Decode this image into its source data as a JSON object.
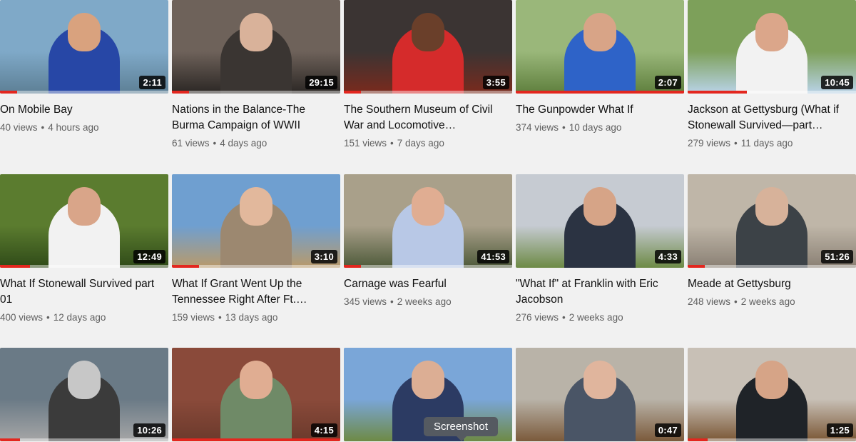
{
  "videos": [
    {
      "title": "On Mobile Bay",
      "views": "40 views",
      "age": "4 hours ago",
      "duration": "2:11",
      "progress": 0.1,
      "bg": "#7fa9c8",
      "bg2": "#5d7f95",
      "shirt": "#2747a6",
      "skin": "#d9a27e"
    },
    {
      "title": "Nations in the Balance-The Burma Campaign of WWII",
      "views": "61 views",
      "age": "4 days ago",
      "duration": "29:15",
      "progress": 0.1,
      "bg": "#6e625a",
      "bg2": "#2b2724",
      "shirt": "#3a3532",
      "skin": "#d9b29a"
    },
    {
      "title": "The Southern Museum of Civil War and Locomotive…",
      "views": "151 views",
      "age": "7 days ago",
      "duration": "3:55",
      "progress": 0.1,
      "bg": "#3b3433",
      "bg2": "#7a2a1d",
      "shirt": "#d52b2b",
      "skin": "#6a3f2a"
    },
    {
      "title": "The Gunpowder What If",
      "views": "374 views",
      "age": "10 days ago",
      "duration": "2:07",
      "progress": 1.0,
      "bg": "#9ab77a",
      "bg2": "#5f7f3d",
      "shirt": "#2e63c8",
      "skin": "#d8a487"
    },
    {
      "title": "Jackson at Gettysburg (What if Stonewall Survived—part…",
      "views": "279 views",
      "age": "11 days ago",
      "duration": "10:45",
      "progress": 0.35,
      "bg": "#7da05a",
      "bg2": "#b9d3e8",
      "shirt": "#f2f2f2",
      "skin": "#dba68a"
    },
    {
      "title": "What If Stonewall Survived part 01",
      "views": "400 views",
      "age": "12 days ago",
      "duration": "12:49",
      "progress": 0.18,
      "bg": "#5b7c2f",
      "bg2": "#2f4a18",
      "shirt": "#f2f2f2",
      "skin": "#d9a589"
    },
    {
      "title": "What If Grant Went Up the Tennessee Right After Ft.…",
      "views": "159 views",
      "age": "13 days ago",
      "duration": "3:10",
      "progress": 0.16,
      "bg": "#6f9fd0",
      "bg2": "#b99a6a",
      "shirt": "#9c8870",
      "skin": "#e2b89c"
    },
    {
      "title": "Carnage was Fearful",
      "views": "345 views",
      "age": "2 weeks ago",
      "duration": "41:53",
      "progress": 0.1,
      "bg": "#a9a08a",
      "bg2": "#4e5a3a",
      "shirt": "#b8c8e6",
      "skin": "#e0ad92"
    },
    {
      "title": "\"What If\" at Franklin with Eric Jacobson",
      "views": "276 views",
      "age": "2 weeks ago",
      "duration": "4:33",
      "progress": 0.0,
      "bg": "#c6cbd2",
      "bg2": "#6d8a45",
      "shirt": "#2b3342",
      "skin": "#d6a487"
    },
    {
      "title": "Meade at Gettysburg",
      "views": "248 views",
      "age": "2 weeks ago",
      "duration": "51:26",
      "progress": 0.1,
      "bg": "#bfb6a8",
      "bg2": "#8a8074",
      "shirt": "#3c4247",
      "skin": "#d7b29a"
    },
    {
      "title": "",
      "views": "",
      "age": "",
      "duration": "10:26",
      "progress": 0.12,
      "bg": "#6a7a86",
      "bg2": "#a6a6a6",
      "shirt": "#3b3b3b",
      "skin": "#c7c7c7"
    },
    {
      "title": "",
      "views": "",
      "age": "",
      "duration": "4:15",
      "progress": 1.0,
      "bg": "#8a4a3a",
      "bg2": "#6b3a2c",
      "shirt": "#6f8a67",
      "skin": "#e0ad92"
    },
    {
      "title": "",
      "views": "",
      "age": "",
      "duration": "",
      "progress": 0.0,
      "bg": "#7aa6d8",
      "bg2": "#6e8a45",
      "shirt": "#2c3b63",
      "skin": "#dcae94"
    },
    {
      "title": "",
      "views": "",
      "age": "",
      "duration": "0:47",
      "progress": 0.0,
      "bg": "#b9b3a8",
      "bg2": "#7b5a3b",
      "shirt": "#4a5566",
      "skin": "#e0b59d"
    },
    {
      "title": "",
      "views": "",
      "age": "",
      "duration": "1:25",
      "progress": 0.12,
      "bg": "#c8c0b6",
      "bg2": "#7a5634",
      "shirt": "#1f2328",
      "skin": "#d6a487"
    }
  ],
  "tooltip": {
    "label": "Screenshot"
  },
  "icons": {
    "separator": "•"
  }
}
